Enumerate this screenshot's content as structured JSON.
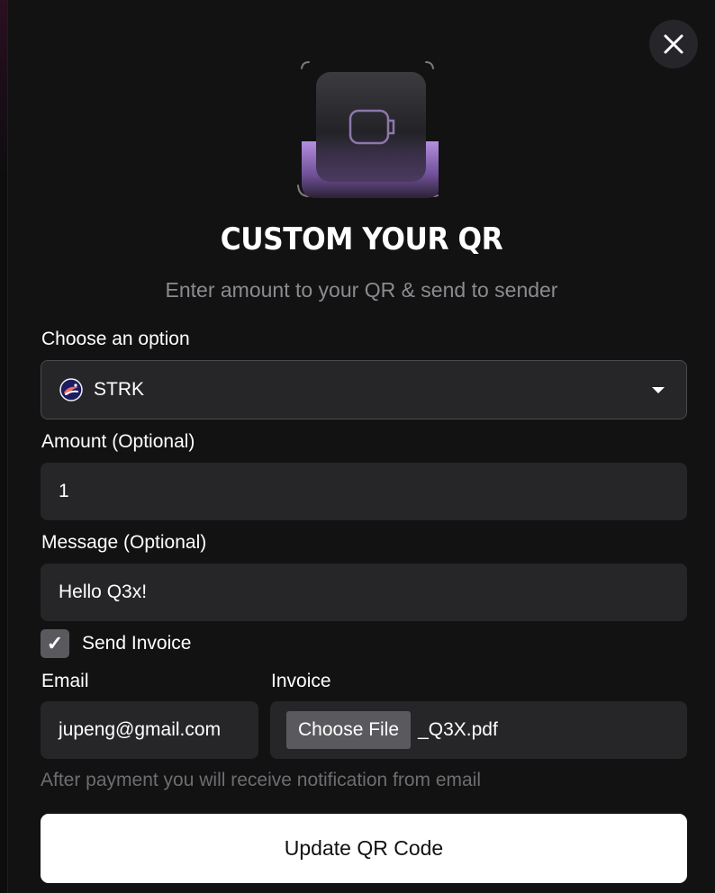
{
  "modal": {
    "title": "CUSTOM YOUR QR",
    "subtitle": "Enter amount to your QR & send to sender"
  },
  "form": {
    "option_label": "Choose an option",
    "option_value": "STRK",
    "option_icon": "starknet-token-icon",
    "amount_label": "Amount (Optional)",
    "amount_value": "1",
    "message_label": "Message (Optional)",
    "message_value": "Hello Q3x!",
    "send_invoice_label": "Send Invoice",
    "send_invoice_checked": true,
    "checkmark": "✓",
    "email_label": "Email",
    "email_value": "jupeng@gmail.com",
    "invoice_label": "Invoice",
    "choose_file_label": "Choose File",
    "file_name": "_Q3X.pdf",
    "hint": "After payment you will receive notification from email",
    "submit_label": "Update QR Code"
  },
  "colors": {
    "background": "#121213",
    "field": "#262628",
    "accent_purple": "#b48ee0",
    "muted_text": "#8b8b90",
    "button": "#ffffff"
  }
}
